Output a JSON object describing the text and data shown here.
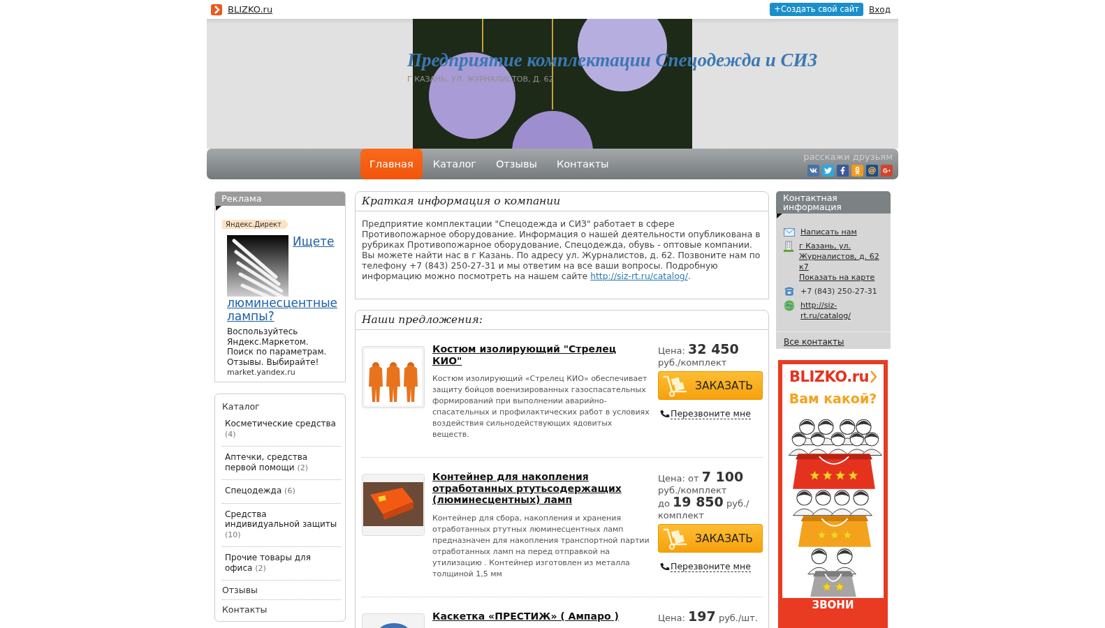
{
  "topbar": {
    "brand": "BLIZKO.ru",
    "create_button": "+Создать свой сайт",
    "login": "Вход"
  },
  "header": {
    "title": "Предприятие комплектации Спецодежда и СИЗ",
    "subtitle": "Г КАЗАНЬ, УЛ. ЖУРНАЛИСТОВ, Д. 62"
  },
  "nav": [
    {
      "label": "Главная",
      "selected": true
    },
    {
      "label": "Каталог",
      "selected": false
    },
    {
      "label": "Отзывы",
      "selected": false
    },
    {
      "label": "Контакты",
      "selected": false
    }
  ],
  "share": {
    "label": "расскажи друзьям"
  },
  "ad": {
    "header": "Реклама",
    "source": "Яндекс.Директ",
    "title": "Ищете люминесцентные лампы?",
    "text": "Воспользуйтесь Яндекс.Маркетом. Поиск по параметрам. Отзывы. Выбирайте!",
    "domain": "market.yandex.ru"
  },
  "catalog": {
    "title": "Каталог",
    "items": [
      {
        "label": "Косметические средства",
        "count": "(4)"
      },
      {
        "label": "Аптечки, средства первой помощи",
        "count": "(2)"
      },
      {
        "label": "Спецодежда",
        "count": "(6)"
      },
      {
        "label": "Средства индивидуальной защиты",
        "count": "(10)"
      },
      {
        "label": "Прочие товары для офиса",
        "count": "(2)"
      }
    ],
    "links": [
      "Отзывы",
      "Контакты"
    ]
  },
  "about": {
    "title": "Краткая информация о компании",
    "text": "Предприятие комплектации \"Спецодежда и СИЗ\" работает в сфере\nПротивопожарное оборудование. Информация о нашей деятельности опубликована в рубриках Противопожарное оборудование, Спецодежда, обувь - оптовые компании. Вы можете найти нас в г Казань. По адресу ул. Журналистов, д. 62. Позвоните нам по телефону +7 (843) 250-27-31 и мы ответим на все ваши вопросы. Подробную информацию можно посмотреть на нашем сайте",
    "link": "http://siz-rt.ru/catalog/",
    "text_after": "."
  },
  "offers": {
    "title": "Наши предложения:",
    "products": [
      {
        "title": "Костюм изолирующий \"Стрелец КИО\"",
        "description": "Костюм изолирующий «Стрелец КИО» обеспечивает защиту бойцов военизированных газоспасательных формирований при выполнении аварийно-спасательных и профилактических работ в условиях воздействия сильнодействующих ядовитых веществ.",
        "prices": [
          {
            "label": "Цена:",
            "amount": "32 450",
            "unit": "руб./комплект"
          }
        ],
        "order_label": "ЗАКАЗАТЬ",
        "callback": "Перезвоните мне"
      },
      {
        "title": "Контейнер для накопления отработанных ртутьсодержащих (люминесцентных) ламп",
        "description": "Контейнер для сбора, накопления и хранения отработанных ртутных люминесцентных ламп предназначен для накопления транспортной партии отработанных ламп на перед отправкой на утилизацию . Контейнер изготовлен из металла толщиной 1,5 мм",
        "prices": [
          {
            "label": "Цена: от",
            "amount": "7 100",
            "unit": "руб./комплект"
          },
          {
            "label": "до",
            "amount": "19 850",
            "unit": "руб./комплект"
          }
        ],
        "order_label": "ЗАКАЗАТЬ",
        "callback": "Перезвоните мне"
      },
      {
        "title": "Каскетка «ПРЕСТИЖ» ( Ампаро )",
        "prices": [
          {
            "label": "Цена:",
            "amount": "197",
            "unit": "руб./шт."
          }
        ]
      }
    ]
  },
  "contacts": {
    "title": "Контактная информация",
    "items": [
      {
        "kind": "mail",
        "links": [
          "Написать нам"
        ]
      },
      {
        "kind": "address",
        "links": [
          "г Казань, ул. Журналистов, д. 62 к7",
          "Показать на карте"
        ]
      },
      {
        "kind": "phone",
        "text": "+7 (843) 250-27-31"
      },
      {
        "kind": "site",
        "links": [
          "http://siz-rt.ru/catalog/"
        ]
      }
    ],
    "all_link": "Все контакты"
  },
  "banner": {
    "brand": "BLIZKO.ru",
    "slogan": "Вам какой?",
    "call": "ЗВОНИ"
  }
}
